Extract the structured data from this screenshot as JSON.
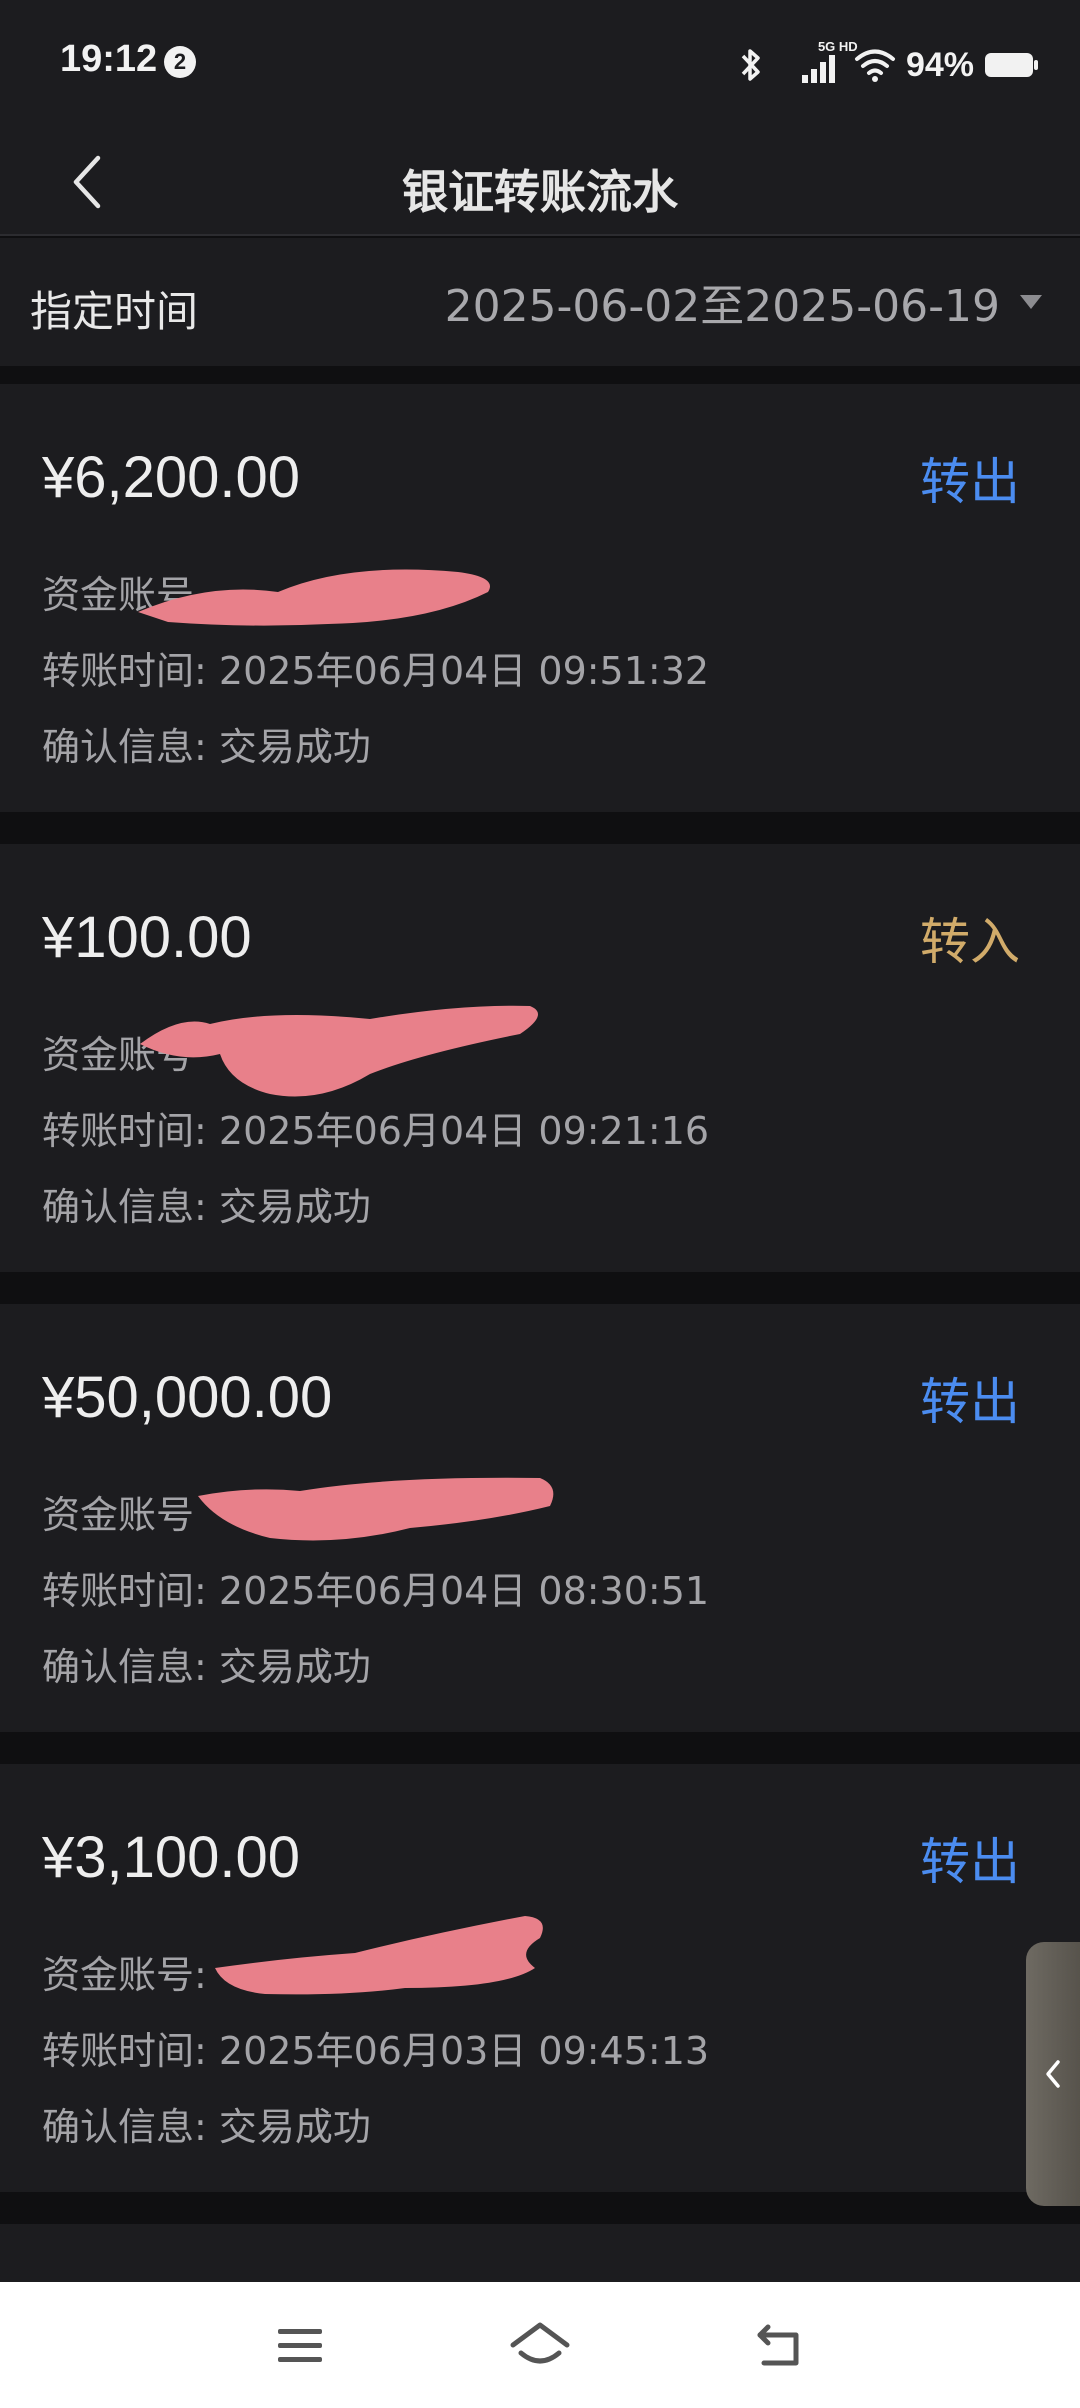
{
  "status_bar": {
    "time": "19:12",
    "notification_count": "2",
    "network_label": "5G HD",
    "battery_percent": "94%"
  },
  "header": {
    "title": "银证转账流水",
    "back_icon": "chevron-left-icon"
  },
  "filter": {
    "label": "指定时间",
    "value": "2025-06-02至2025-06-19",
    "dropdown_icon": "triangle-down-icon"
  },
  "records": [
    {
      "amount": "¥6,200.00",
      "direction": "转出",
      "account_label": "资金账号",
      "time_label": "转账时间:",
      "time_value": "2025年06月04日 09:51:32",
      "confirm_label": "确认信息:",
      "confirm_value": "交易成功"
    },
    {
      "amount": "¥100.00",
      "direction": "转入",
      "account_label": "资金账号",
      "time_label": "转账时间:",
      "time_value": "2025年06月04日 09:21:16",
      "confirm_label": "确认信息:",
      "confirm_value": "交易成功"
    },
    {
      "amount": "¥50,000.00",
      "direction": "转出",
      "account_label": "资金账号",
      "time_label": "转账时间:",
      "time_value": "2025年06月04日 08:30:51",
      "confirm_label": "确认信息:",
      "confirm_value": "交易成功"
    },
    {
      "amount": "¥3,100.00",
      "direction": "转出",
      "account_label": "资金账号:",
      "time_label": "转账时间:",
      "time_value": "2025年06月03日 09:45:13",
      "confirm_label": "确认信息:",
      "confirm_value": "交易成功"
    }
  ],
  "colors": {
    "out": "#4b8cf0",
    "in": "#d1ab6a",
    "card_bg": "#1c1c1f",
    "page_bg": "#0f0f11",
    "redaction": "#e8808a"
  },
  "nav": {
    "menu_icon": "menu-icon",
    "home_icon": "home-icon",
    "back_icon": "back-arrow-icon"
  },
  "side_tab_icon": "chevron-left-icon"
}
